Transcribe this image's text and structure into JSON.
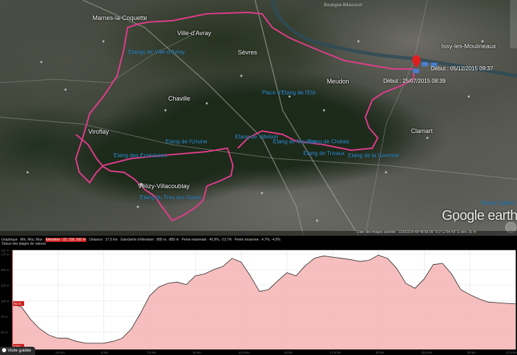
{
  "map": {
    "towns": [
      "Marnes-la-Coquette",
      "Chaville",
      "Viroflay",
      "Vélizy-Villacoublay",
      "Meudon",
      "Clamart",
      "Sèvres",
      "Ville-d'Avray",
      "Issy-les-Moulineaux",
      "Boulogne-Billancourt"
    ],
    "water": [
      "Etang de l'Ursine",
      "Etang des Ecrevisses",
      "Etang du Trou aux Gants",
      "Etang de Villebon",
      "Etang de Meudon",
      "Etang de Chalais",
      "Etang de Trivaux",
      "Etang de la Garenne",
      "Etangs de Ville-d'Avray",
      "Place d'Etang de l'Eté",
      "Etang Colbert"
    ],
    "markers": {
      "debut1": "Début : 25/07/2015 08:39",
      "debut2": "Début : 05/12/2015 09:37"
    },
    "attribution": "Date des images satellite : 31/8/2014 48°48'58.05\" N 2°12'54.49\" E élév. 91 m",
    "logo": "Google earth",
    "colors": {
      "track": "#e23c8c",
      "water_label": "#3a9bdc"
    }
  },
  "profile": {
    "stats_row1": [
      "Graphique",
      "Min, Moy, Max",
      "Elévation : 22, 118, 181 m",
      "Distance : 27,5 km",
      "Gain/perte d'élévation : 885 m, -885 m",
      "Pente maximale : 40,9%, -23,7%",
      "Pente moyenne : 4,7%, -4,9%"
    ],
    "stats_row2": "Totaux des plages de valeurs",
    "y_labels": [
      "181 m",
      "175 m",
      "150 m",
      "125 m",
      "100 m",
      "75 m",
      "50 m",
      "25 m"
    ],
    "x_labels": [
      "0 km",
      "2,5 km",
      "5 km",
      "7,5 km",
      "10 km",
      "12,5 km",
      "15 km",
      "17,5 km",
      "20 km",
      "22,5 km",
      "25 km",
      "27,5 km"
    ],
    "cursor_values": [
      "91 m",
      "0 km"
    ],
    "guided_tour": "Visite guidée"
  },
  "chart_data": {
    "type": "area",
    "xlabel": "",
    "ylabel": "",
    "x_unit": "km",
    "y_unit": "m",
    "xlim": [
      0,
      27.5
    ],
    "ylim": [
      22,
      181
    ],
    "x": [
      0,
      0.5,
      1,
      1.5,
      2,
      2.5,
      3,
      3.5,
      4,
      4.5,
      5,
      5.5,
      6,
      6.5,
      7,
      7.5,
      8,
      8.5,
      9,
      9.5,
      10,
      10.5,
      11,
      11.5,
      12,
      12.5,
      13,
      13.5,
      14,
      14.5,
      15,
      15.5,
      16,
      16.5,
      17,
      17.5,
      18,
      18.5,
      19,
      19.5,
      20,
      20.5,
      21,
      21.5,
      22,
      22.5,
      23,
      23.5,
      24,
      24.5,
      25,
      25.5,
      26,
      26.5,
      27,
      27.5
    ],
    "y": [
      95,
      90,
      70,
      55,
      45,
      40,
      40,
      35,
      32,
      32,
      32,
      35,
      40,
      55,
      80,
      108,
      122,
      128,
      130,
      126,
      140,
      143,
      150,
      155,
      168,
      162,
      140,
      115,
      118,
      132,
      145,
      140,
      156,
      168,
      172,
      170,
      168,
      166,
      163,
      165,
      173,
      168,
      152,
      128,
      120,
      135,
      158,
      160,
      143,
      118,
      110,
      103,
      98,
      97,
      96,
      95
    ]
  }
}
